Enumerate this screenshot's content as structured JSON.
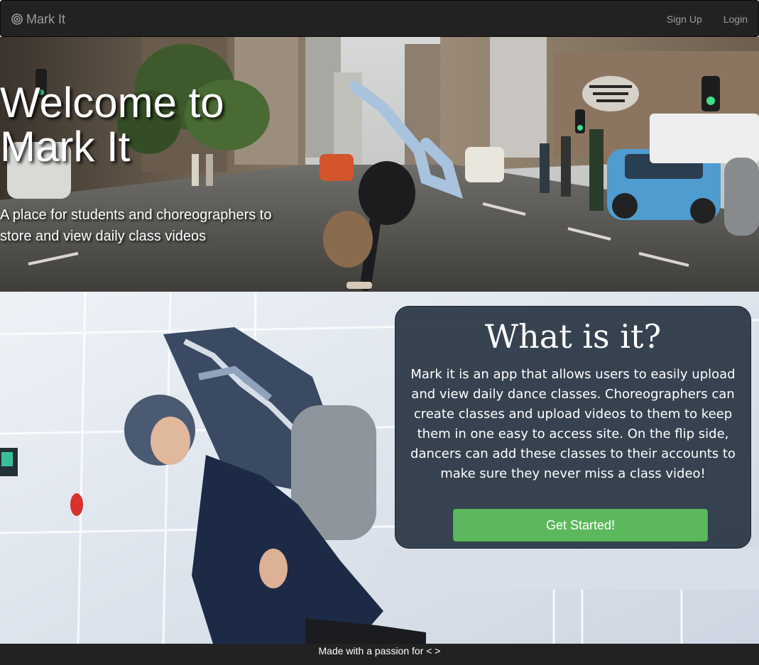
{
  "navbar": {
    "brand_icon": "target-icon",
    "brand_label": "Mark It",
    "links": [
      {
        "label": "Sign Up"
      },
      {
        "label": "Login"
      }
    ]
  },
  "hero": {
    "title": "Welcome to Mark It",
    "subtitle": "A place for students and choreographers to store and view daily class videos"
  },
  "about": {
    "title": "What is it?",
    "body": "Mark it is an app that allows users to easily upload and view daily dance classes. Choreographers can create classes and upload videos to them to keep them in one easy to access site. On the flip side, dancers can add these classes to their accounts to make sure they never miss a class video!",
    "cta_label": "Get Started!"
  },
  "footer": {
    "text": "Made with a passion for < >"
  },
  "colors": {
    "navbar_bg": "#222222",
    "nav_text": "#9d9d9d",
    "card_bg": "#283442",
    "cta": "#5cb85c",
    "footer_bg": "#222222"
  }
}
